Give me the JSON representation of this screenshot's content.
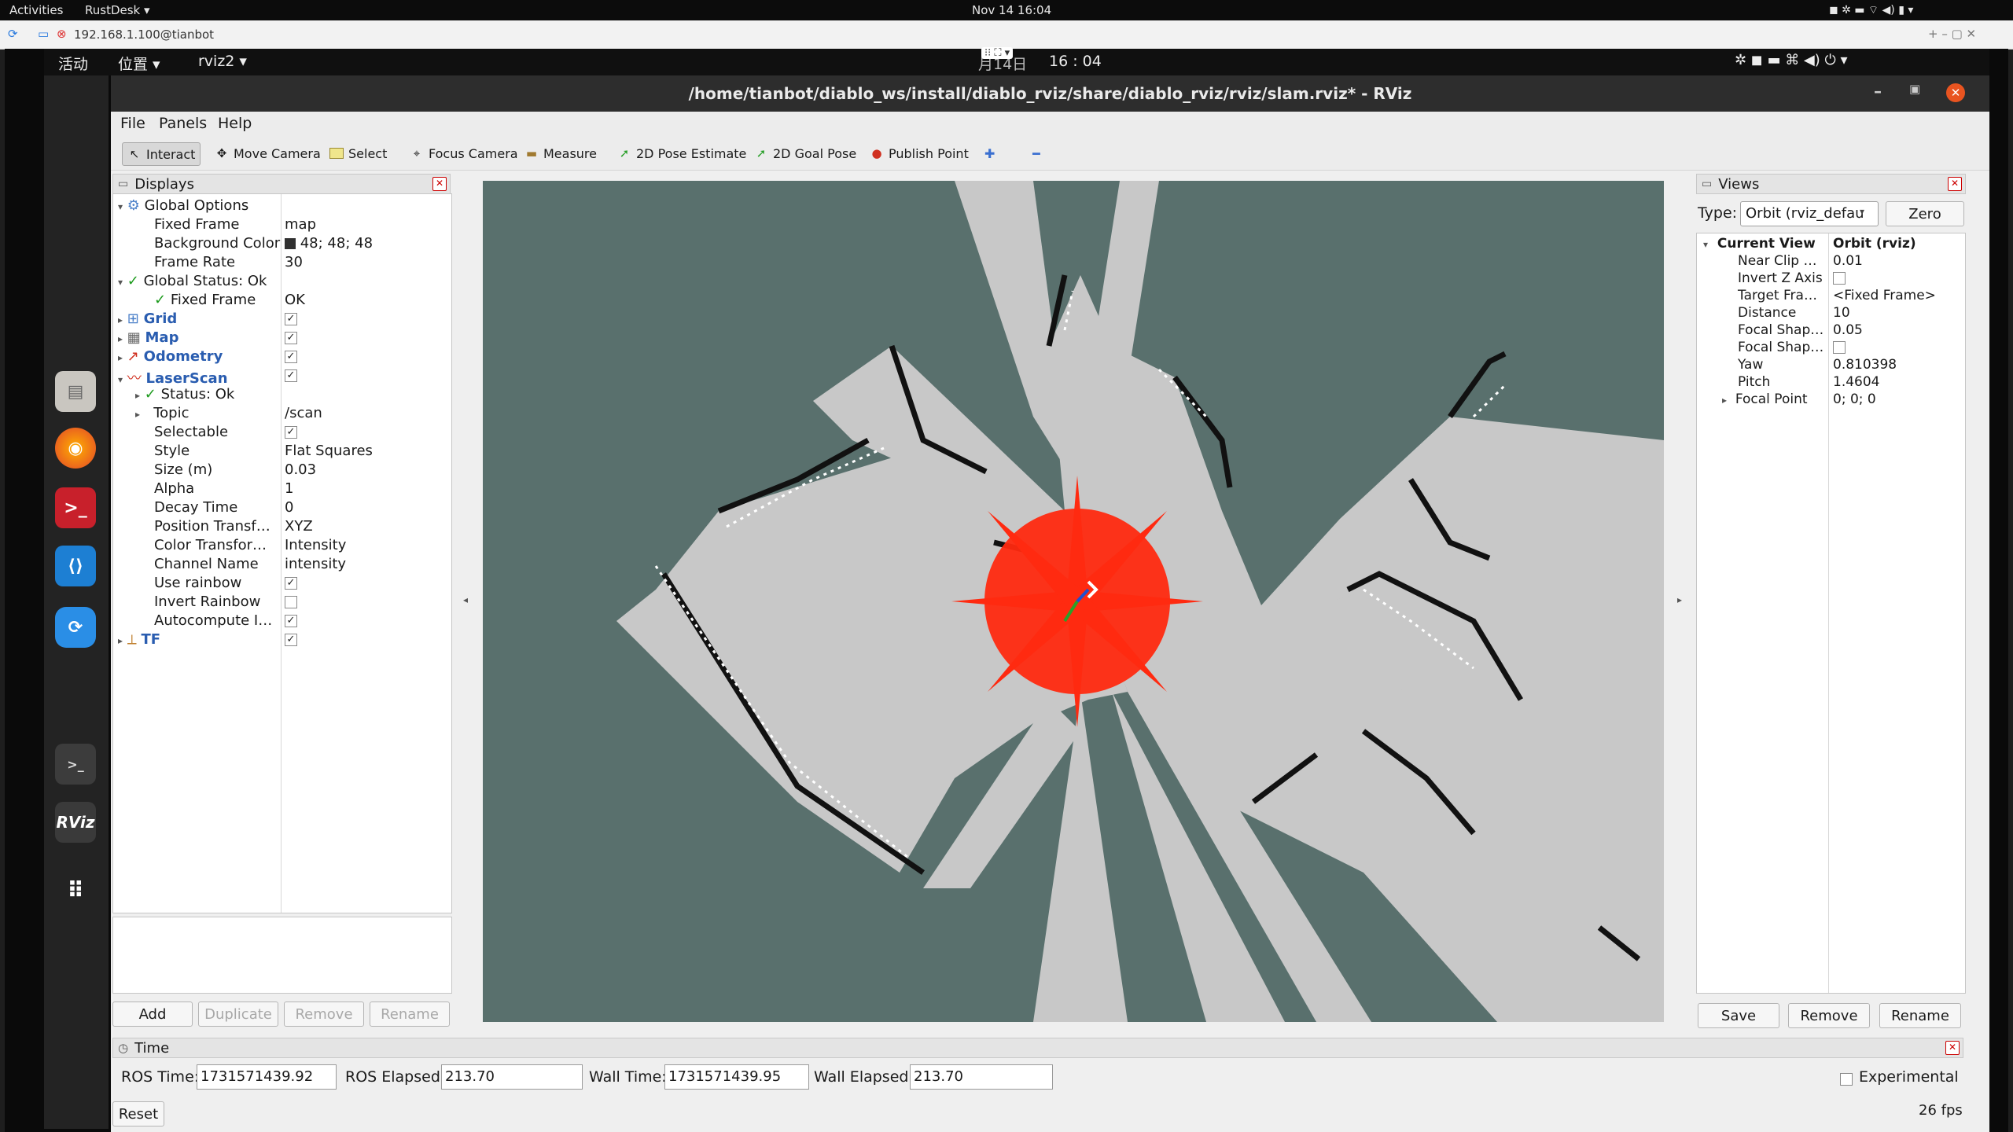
{
  "host_topbar": {
    "activities": "Activities",
    "app": "RustDesk ▾",
    "clock": "Nov 14  16:04"
  },
  "rustdesk": {
    "address": "192.168.1.100@tianbot"
  },
  "remote_topbar": {
    "activities": "活动",
    "places": "位置 ▾",
    "app": "rviz2 ▾",
    "clock": "16 : 04",
    "partial_date": "月14日"
  },
  "window": {
    "title": "/home/tianbot/diablo_ws/install/diablo_rviz/share/diablo_rviz/rviz/slam.rviz* - RViz"
  },
  "menu": {
    "file": "File",
    "panels": "Panels",
    "help": "Help"
  },
  "toolbar": {
    "interact": "Interact",
    "move_camera": "Move Camera",
    "select": "Select",
    "focus_camera": "Focus Camera",
    "measure": "Measure",
    "pose_estimate": "2D Pose Estimate",
    "goal_pose": "2D Goal Pose",
    "publish_point": "Publish Point",
    "plus": "✚",
    "minus": "━"
  },
  "displays": {
    "title": "Displays",
    "rows": [
      {
        "label": "Global Options",
        "value": ""
      },
      {
        "label": "Fixed Frame",
        "value": "map"
      },
      {
        "label": "Background Color",
        "value": "48; 48; 48"
      },
      {
        "label": "Frame Rate",
        "value": "30"
      },
      {
        "label": "Global Status: Ok",
        "value": ""
      },
      {
        "label": "Fixed Frame",
        "value": "OK"
      },
      {
        "label": "Grid",
        "value": ""
      },
      {
        "label": "Map",
        "value": ""
      },
      {
        "label": "Odometry",
        "value": ""
      },
      {
        "label": "LaserScan",
        "value": ""
      },
      {
        "label": "Status: Ok",
        "value": ""
      },
      {
        "label": "Topic",
        "value": "/scan"
      },
      {
        "label": "Selectable",
        "value": ""
      },
      {
        "label": "Style",
        "value": "Flat Squares"
      },
      {
        "label": "Size (m)",
        "value": "0.03"
      },
      {
        "label": "Alpha",
        "value": "1"
      },
      {
        "label": "Decay Time",
        "value": "0"
      },
      {
        "label": "Position Transf…",
        "value": "XYZ"
      },
      {
        "label": "Color Transfor…",
        "value": "Intensity"
      },
      {
        "label": "Channel Name",
        "value": "intensity"
      },
      {
        "label": "Use rainbow",
        "value": ""
      },
      {
        "label": "Invert Rainbow",
        "value": ""
      },
      {
        "label": "Autocompute I…",
        "value": ""
      },
      {
        "label": "TF",
        "value": ""
      }
    ],
    "buttons": {
      "add": "Add",
      "duplicate": "Duplicate",
      "remove": "Remove",
      "rename": "Rename"
    },
    "bg_color": "#303030"
  },
  "views": {
    "title": "Views",
    "type_label": "Type:",
    "type_value": "Orbit (rviz_defau",
    "zero": "Zero",
    "rows": [
      {
        "label": "Current View",
        "value": "Orbit (rviz)"
      },
      {
        "label": "Near Clip …",
        "value": "0.01"
      },
      {
        "label": "Invert Z Axis",
        "value": ""
      },
      {
        "label": "Target Fra…",
        "value": "<Fixed Frame>"
      },
      {
        "label": "Distance",
        "value": "10"
      },
      {
        "label": "Focal Shap…",
        "value": "0.05"
      },
      {
        "label": "Focal Shap…",
        "value": ""
      },
      {
        "label": "Yaw",
        "value": "0.810398"
      },
      {
        "label": "Pitch",
        "value": "1.4604"
      },
      {
        "label": "Focal Point",
        "value": "0; 0; 0"
      }
    ],
    "buttons": {
      "save": "Save",
      "remove": "Remove",
      "rename": "Rename"
    }
  },
  "time": {
    "title": "Time",
    "ros_time_label": "ROS Time:",
    "ros_time": "1731571439.92",
    "ros_elapsed_label": "ROS Elapsed:",
    "ros_elapsed": "213.70",
    "wall_time_label": "Wall Time:",
    "wall_time": "1731571439.95",
    "wall_elapsed_label": "Wall Elapsed:",
    "wall_elapsed": "213.70",
    "experimental": "Experimental",
    "reset": "Reset",
    "fps": "26 fps"
  },
  "colors": {
    "viewport_bg": "#59706d",
    "free_space": "#c8c8c8",
    "laser": "#ff2a10",
    "titlebar": "#2d2d2d",
    "close_btn": "#e95420"
  }
}
